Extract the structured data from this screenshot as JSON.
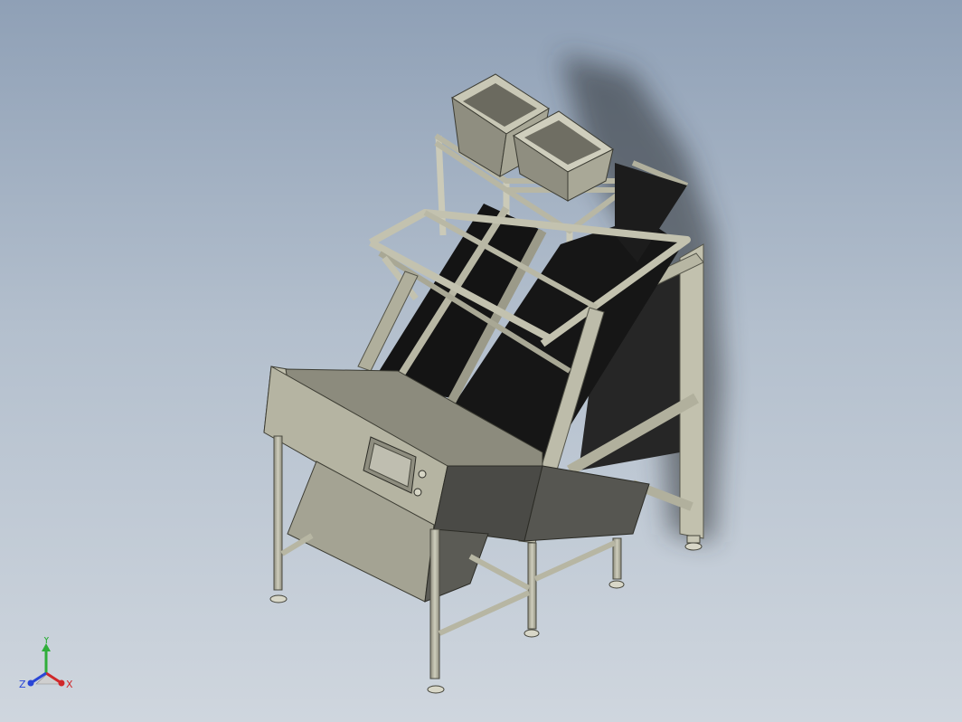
{
  "view": {
    "background_top": "#8fa0b6",
    "background_bottom": "#cfd6de",
    "frame_color": "#b9b8a5",
    "belt_color": "#141414",
    "panel_color": "#a5a596"
  },
  "triad": {
    "x_label": "X",
    "y_label": "Y",
    "z_label": "Z",
    "x_color": "#d0282a",
    "y_color": "#2fae3a",
    "z_color": "#2a46d6"
  }
}
